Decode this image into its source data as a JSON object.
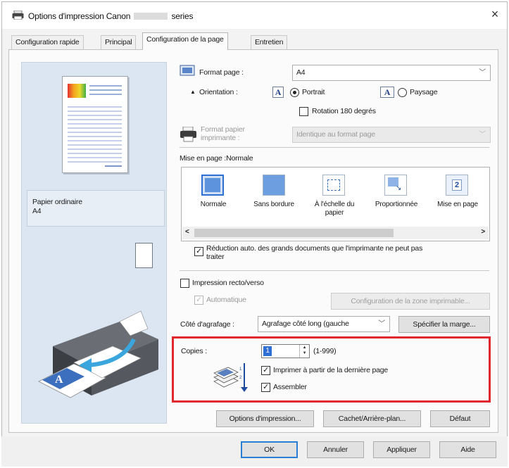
{
  "window": {
    "title": "Options d'impression Canon",
    "title_suffix": "series",
    "close_icon": "×"
  },
  "tabs": [
    {
      "label": "Configuration rapide"
    },
    {
      "label": "Principal"
    },
    {
      "label": "Configuration de la page"
    },
    {
      "label": "Entretien"
    }
  ],
  "preview": {
    "media_type": "Papier ordinaire",
    "media_size": "A4"
  },
  "page_setup": {
    "format_label": "Format page :",
    "format_value": "A4",
    "orientation_label": "Orientation :",
    "portrait_label": "Portrait",
    "landscape_label": "Paysage",
    "orientation_icon_text": "A",
    "rotate_label": "Rotation 180 degrés",
    "printer_paper_label_1": "Format papier",
    "printer_paper_label_2": "imprimante :",
    "printer_paper_value": "Identique au format page",
    "layout_label": "Mise en page :Normale",
    "layouts": [
      {
        "label": "Normale"
      },
      {
        "label": "Sans bordure"
      },
      {
        "label": "À l'échelle du",
        "label2": "papier"
      },
      {
        "label": "Proportionnée"
      },
      {
        "label": "Mise en page"
      }
    ],
    "multipage_number": "2",
    "scroll_left": "<",
    "scroll_right": ">",
    "auto_reduce_label_1": "Réduction auto. des grands documents que l'imprimante ne peut pas",
    "auto_reduce_label_2": "traiter",
    "duplex_label": "Impression recto/verso",
    "auto_label": "Automatique",
    "print_area_button": "Configuration de la zone imprimable...",
    "stapling_label": "Côté d'agrafage :",
    "stapling_value": "Agrafage côté long (gauche",
    "margin_button": "Spécifier la marge...",
    "copies_label": "Copies :",
    "copies_value": "1",
    "copies_range": "(1-999)",
    "last_page_label": "Imprimer à partir de la dernière page",
    "collate_label": "Assembler",
    "print_options_button": "Options d'impression...",
    "stamp_button": "Cachet/Arrière-plan...",
    "defaults_button": "Défaut"
  },
  "footer": {
    "ok": "OK",
    "cancel": "Annuler",
    "apply": "Appliquer",
    "help": "Aide"
  },
  "colors": {
    "highlight_box": "#e0282e",
    "selection": "#2f6fd3",
    "preview_bg": "#dbe6f2"
  }
}
